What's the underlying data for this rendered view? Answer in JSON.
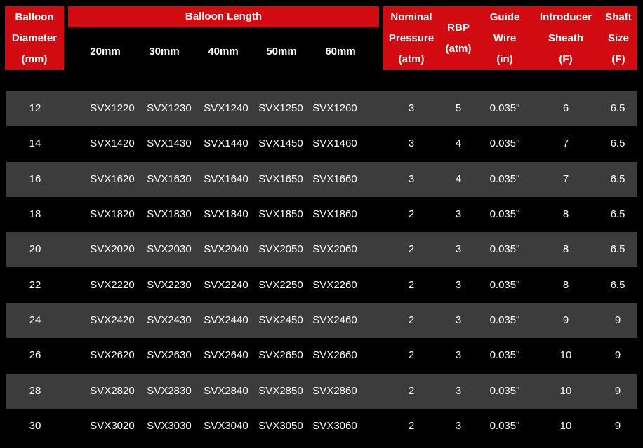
{
  "headers": {
    "diameter": [
      "Balloon",
      "Diameter",
      "(mm)"
    ],
    "length_title": "Balloon Length",
    "lengths": [
      "20mm",
      "30mm",
      "40mm",
      "50mm",
      "60mm"
    ],
    "nominal": [
      "Nominal",
      "Pressure",
      "(atm)"
    ],
    "rbp": [
      "RBP",
      "(atm)"
    ],
    "guide": [
      "Guide",
      "Wire",
      "(in)"
    ],
    "introducer": [
      "Introducer",
      "Sheath",
      "(F)"
    ],
    "shaft": [
      "Shaft",
      "Size",
      "(F)"
    ]
  },
  "rows": [
    {
      "diameter": "12",
      "models": [
        "SVX1220",
        "SVX1230",
        "SVX1240",
        "SVX1250",
        "SVX1260"
      ],
      "nominal": "3",
      "rbp": "5",
      "guide": "0.035\"",
      "introducer": "6",
      "shaft": "6.5"
    },
    {
      "diameter": "14",
      "models": [
        "SVX1420",
        "SVX1430",
        "SVX1440",
        "SVX1450",
        "SVX1460"
      ],
      "nominal": "3",
      "rbp": "4",
      "guide": "0.035\"",
      "introducer": "7",
      "shaft": "6.5"
    },
    {
      "diameter": "16",
      "models": [
        "SVX1620",
        "SVX1630",
        "SVX1640",
        "SVX1650",
        "SVX1660"
      ],
      "nominal": "3",
      "rbp": "4",
      "guide": "0.035\"",
      "introducer": "7",
      "shaft": "6.5"
    },
    {
      "diameter": "18",
      "models": [
        "SVX1820",
        "SVX1830",
        "SVX1840",
        "SVX1850",
        "SVX1860"
      ],
      "nominal": "2",
      "rbp": "3",
      "guide": "0.035\"",
      "introducer": "8",
      "shaft": "6.5"
    },
    {
      "diameter": "20",
      "models": [
        "SVX2020",
        "SVX2030",
        "SVX2040",
        "SVX2050",
        "SVX2060"
      ],
      "nominal": "2",
      "rbp": "3",
      "guide": "0.035\"",
      "introducer": "8",
      "shaft": "6.5"
    },
    {
      "diameter": "22",
      "models": [
        "SVX2220",
        "SVX2230",
        "SVX2240",
        "SVX2250",
        "SVX2260"
      ],
      "nominal": "2",
      "rbp": "3",
      "guide": "0.035\"",
      "introducer": "8",
      "shaft": "6.5"
    },
    {
      "diameter": "24",
      "models": [
        "SVX2420",
        "SVX2430",
        "SVX2440",
        "SVX2450",
        "SVX2460"
      ],
      "nominal": "2",
      "rbp": "3",
      "guide": "0.035\"",
      "introducer": "9",
      "shaft": "9"
    },
    {
      "diameter": "26",
      "models": [
        "SVX2620",
        "SVX2630",
        "SVX2640",
        "SVX2650",
        "SVX2660"
      ],
      "nominal": "2",
      "rbp": "3",
      "guide": "0.035\"",
      "introducer": "10",
      "shaft": "9"
    },
    {
      "diameter": "28",
      "models": [
        "SVX2820",
        "SVX2830",
        "SVX2840",
        "SVX2850",
        "SVX2860"
      ],
      "nominal": "2",
      "rbp": "3",
      "guide": "0.035\"",
      "introducer": "10",
      "shaft": "9"
    },
    {
      "diameter": "30",
      "models": [
        "SVX3020",
        "SVX3030",
        "SVX3040",
        "SVX3050",
        "SVX3060"
      ],
      "nominal": "2",
      "rbp": "3",
      "guide": "0.035\"",
      "introducer": "10",
      "shaft": "9"
    }
  ],
  "colors": {
    "header_red": "#d20a11",
    "row_shade": "#3c3c3c",
    "background": "#000000",
    "text": "#ffffff"
  }
}
